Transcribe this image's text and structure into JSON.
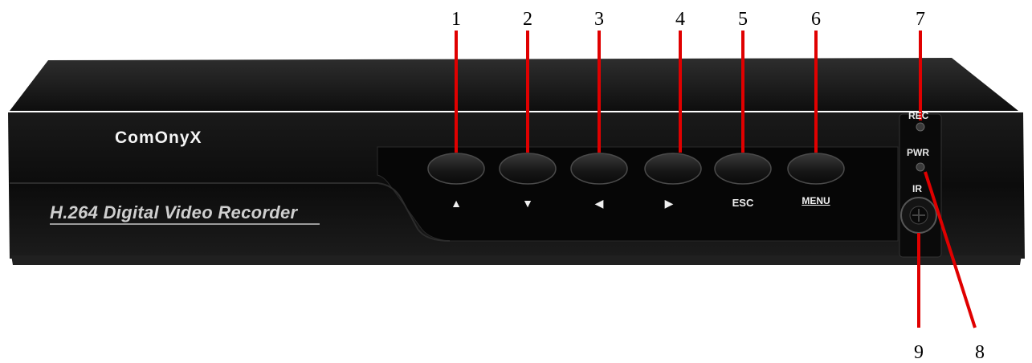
{
  "device": {
    "brand": "ComOnyX",
    "model_text": "H.264 Digital Video Recorder"
  },
  "buttons": [
    {
      "callout": "1",
      "glyph": "▲",
      "icon": "up-arrow-icon"
    },
    {
      "callout": "2",
      "glyph": "▼",
      "icon": "down-arrow-icon"
    },
    {
      "callout": "3",
      "glyph": "◀",
      "icon": "left-arrow-icon"
    },
    {
      "callout": "4",
      "glyph": "▶",
      "icon": "right-arrow-icon"
    },
    {
      "callout": "5",
      "label": "ESC"
    },
    {
      "callout": "6",
      "label": "MENU"
    }
  ],
  "indicators": {
    "rec_label": "REC",
    "pwr_label": "PWR",
    "ir_label": "IR",
    "rec_callout": "7",
    "pwr_callout": "8",
    "ir_callout": "9"
  },
  "colors": {
    "callout_line": "#e00000",
    "body": "#111111"
  }
}
